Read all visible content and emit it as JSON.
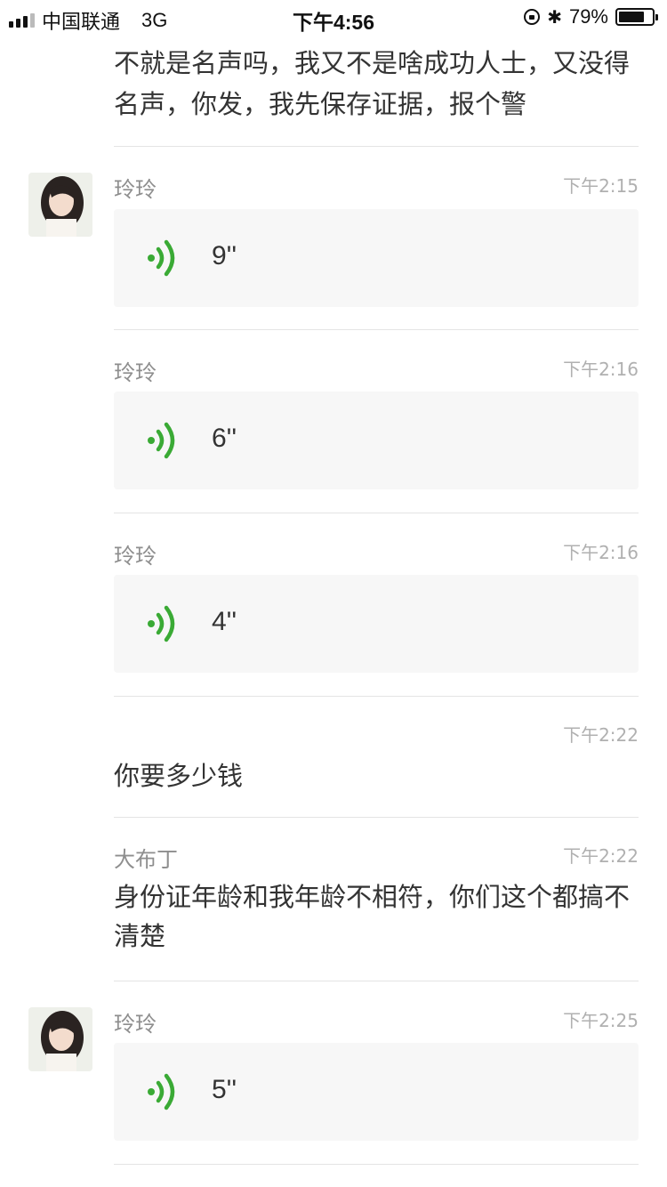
{
  "status_bar": {
    "carrier": "中国联通",
    "network": "3G",
    "time": "下午4:56",
    "battery": "79%",
    "battery_level": 0.79
  },
  "top_message": {
    "text": "不就是名声吗，我又不是啥成功人士，又没得名声，你发，我先保存证据，报个警"
  },
  "messages": [
    {
      "sender": "玲玲",
      "time": "下午2:15",
      "duration": "9''"
    },
    {
      "sender": "玲玲",
      "time": "下午2:16",
      "duration": "6''"
    },
    {
      "sender": "玲玲",
      "time": "下午2:16",
      "duration": "4''"
    },
    {
      "sender": "",
      "time": "下午2:22",
      "text": "你要多少钱"
    },
    {
      "sender": "大布丁",
      "time": "下午2:22",
      "text": "身份证年龄和我年龄不相符，你们这个都搞不清楚"
    },
    {
      "sender": "玲玲",
      "time": "下午2:25",
      "duration": "5''"
    }
  ],
  "colors": {
    "voice_green": "#3aaa35",
    "bubble_bg": "#f7f7f7",
    "divider": "#e4e4e4"
  }
}
